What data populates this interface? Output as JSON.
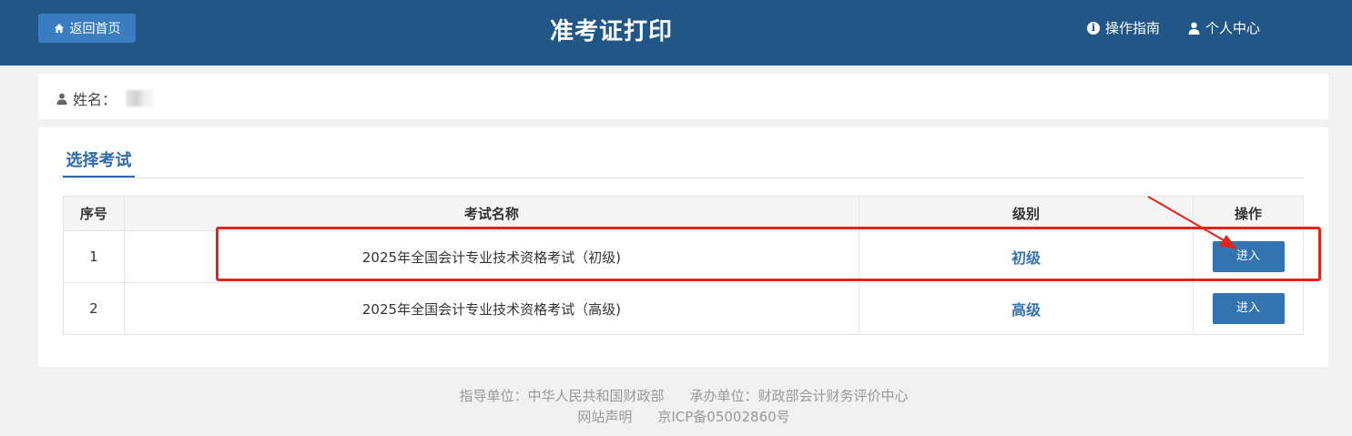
{
  "header": {
    "home_label": "返回首页",
    "title": "准考证打印",
    "guide_label": "操作指南",
    "profile_label": "个人中心"
  },
  "user": {
    "name_label": "姓名："
  },
  "tab": {
    "label": "选择考试"
  },
  "table": {
    "headers": {
      "no": "序号",
      "name": "考试名称",
      "level": "级别",
      "operation": "操作"
    },
    "rows": [
      {
        "no": "1",
        "name": "2025年全国会计专业技术资格考试（初级)",
        "level": "初级",
        "action": "进入"
      },
      {
        "no": "2",
        "name": "2025年全国会计专业技术资格考试（高级)",
        "level": "高级",
        "action": "进入"
      }
    ]
  },
  "footer": {
    "guide_unit": "指导单位：中华人民共和国财政部",
    "host_unit": "承办单位：财政部会计财务评价中心",
    "statement": "网站声明",
    "icp": "京ICP备05002860号"
  },
  "colors": {
    "header_bg": "#215686",
    "accent": "#3274b2",
    "highlight": "#e3241b"
  },
  "icons": [
    "home-icon",
    "info-icon",
    "user-icon",
    "user-icon"
  ]
}
